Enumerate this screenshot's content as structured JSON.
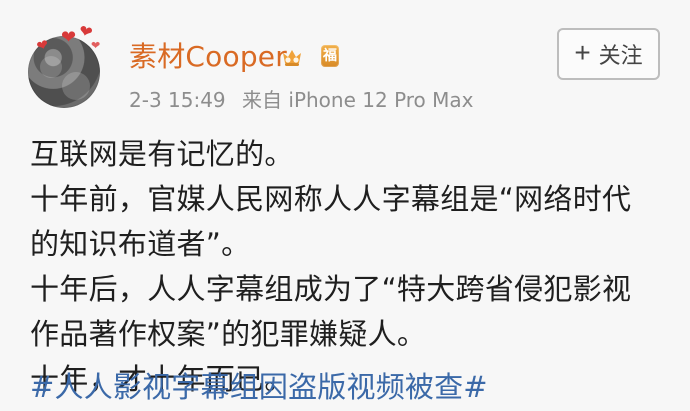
{
  "post": {
    "username": "素材Cooper",
    "timestamp": "2-3 15:49",
    "source_prefix": "来自",
    "source_device": "iPhone 12 Pro Max",
    "follow_button": {
      "plus_symbol": "+",
      "label": "关注"
    },
    "badges": {
      "svip_icon": "vip-crown-icon",
      "fortune_label": "福"
    },
    "content_lines": [
      "互联网是有记忆的。",
      "十年前，官媒人民网称人人字幕组是“网络时代",
      "的知识布道者”。",
      "十年后，人人字幕组成为了“特大跨省侵犯影视",
      "作品著作权案”的犯罪嫌疑人。",
      "十年，才十年而已。"
    ],
    "hashtag": "#人人影视字幕组因盗版视频被查#"
  },
  "colors": {
    "username": "#d96a24",
    "meta": "#8d8d8d",
    "hashtag": "#3b69a8",
    "follow_border": "#bdbdbd",
    "badge": "#f0a23a"
  }
}
